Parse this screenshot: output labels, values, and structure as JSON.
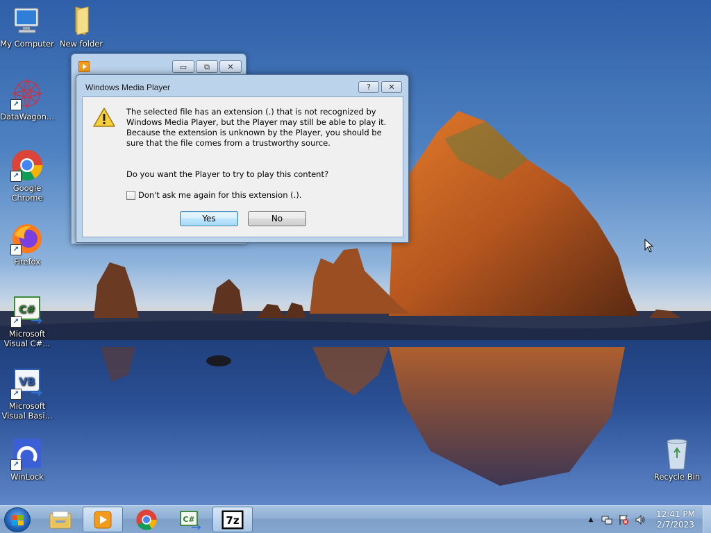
{
  "desktop": {
    "icons": [
      {
        "label": "My Computer",
        "icon": "computer-icon"
      },
      {
        "label": "New folder",
        "icon": "folder-icon"
      },
      {
        "label": "DataWagon...",
        "icon": "datawagon-icon"
      },
      {
        "label": "Google Chrome",
        "icon": "chrome-icon"
      },
      {
        "label": "Firefox",
        "icon": "firefox-icon"
      },
      {
        "label": "Microsoft Visual C#...",
        "icon": "visual-csharp-icon"
      },
      {
        "label": "Microsoft Visual Basi...",
        "icon": "visual-basic-icon"
      },
      {
        "label": "WinLock",
        "icon": "winlock-icon"
      },
      {
        "label": "Recycle Bin",
        "icon": "recycle-bin-icon"
      }
    ]
  },
  "dialog": {
    "title": "Windows Media Player",
    "help_glyph": "?",
    "close_glyph": "✕",
    "message": "The selected file has an extension (.) that is not recognized by Windows Media Player, but the Player may still be able to play it. Because the extension is unknown by the Player, you should be sure that the file comes from a trustworthy source.",
    "question": "Do you want the Player to try to play this content?",
    "checkbox_label": "Don't ask me again for this extension (.).",
    "checkbox_checked": false,
    "yes_label": "Yes",
    "no_label": "No"
  },
  "background_window": {
    "minimize_glyph": "▭",
    "maximize_glyph": "⧉",
    "close_glyph": "✕"
  },
  "taskbar": {
    "items": [
      {
        "name": "windows-explorer",
        "icon": "explorer-icon",
        "active": false
      },
      {
        "name": "windows-media-player",
        "icon": "media-player-icon",
        "active": true
      },
      {
        "name": "google-chrome",
        "icon": "chrome-icon",
        "active": false
      },
      {
        "name": "visual-csharp",
        "icon": "visual-csharp-icon",
        "active": false
      },
      {
        "name": "7-zip",
        "icon": "7zip-icon",
        "active": true
      }
    ],
    "csharp_text": "C#",
    "sevenzip_text": "7z",
    "tray_up_glyph": "▲",
    "clock_time": "12:41 PM",
    "clock_date": "2/7/2023"
  },
  "colors": {
    "dialog_frame": "#bcd3ec",
    "dialog_body": "#f0f0f0",
    "taskbar": "#8eaed4"
  }
}
